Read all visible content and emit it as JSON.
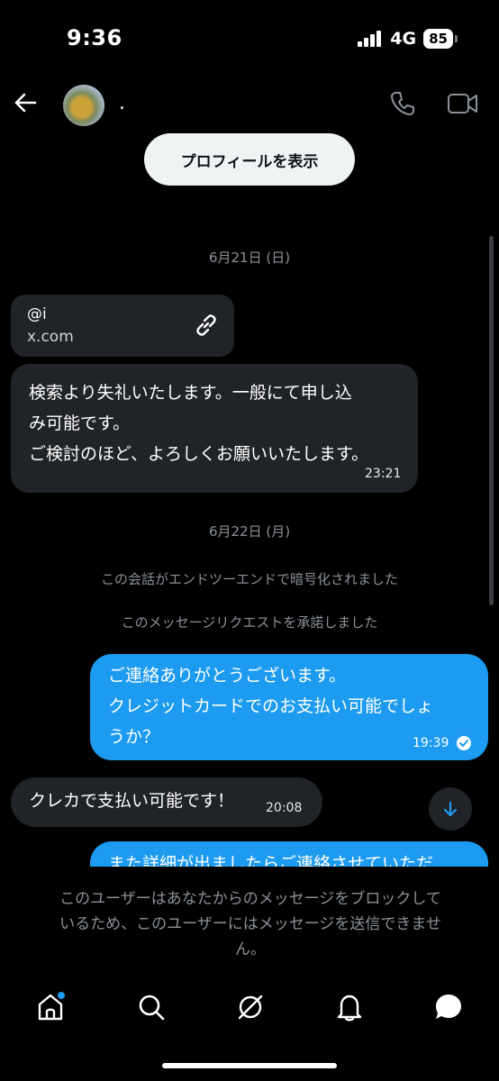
{
  "status": {
    "time": "9:36",
    "network": "4G",
    "battery": "85"
  },
  "header": {
    "name": "."
  },
  "profile_button": "プロフィールを表示",
  "dates": {
    "first": "6月21日 (日)",
    "second": "6月22日 (月)"
  },
  "link_card": {
    "title": "@i",
    "domain": "x.com"
  },
  "messages": {
    "m1": {
      "lines": [
        "検索より失礼いたします。一般にて申し込",
        "み可能です。",
        "ご検討のほど、よろしくお願いいたします。"
      ],
      "time": "23:21"
    },
    "m2": {
      "lines": [
        "ご連絡ありがとうございます。",
        "クレジットカードでのお支払い可能でしょ",
        "うか？"
      ],
      "time": "19:39"
    },
    "m3": {
      "text": "クレカで支払い可能です！",
      "time": "20:08"
    },
    "m4": {
      "text": "また詳細が出ましたらご連絡させていただ"
    }
  },
  "system_notes": {
    "encrypted": "この会話がエンドツーエンドで暗号化されました",
    "accepted": "このメッセージリクエストを承諾しました"
  },
  "blocked_notice": [
    "このユーザーはあなたからのメッセージをブロックして",
    "いるため、このユーザーにはメッセージを送信できませ",
    "ん。"
  ],
  "colors": {
    "accent": "#1d9bf0",
    "incoming_bubble": "#202327",
    "muted": "#8b9198"
  }
}
